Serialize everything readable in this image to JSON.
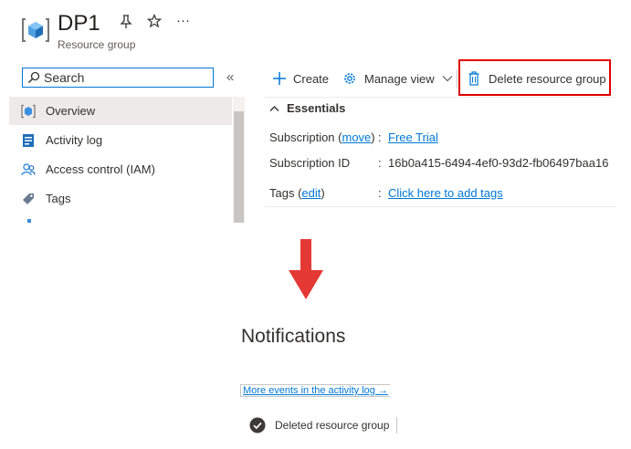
{
  "header": {
    "title": "DP1",
    "subtitle": "Resource group",
    "pin_icon": "pin-icon",
    "star_icon": "star-icon",
    "more_label": "···"
  },
  "search": {
    "placeholder": "Search",
    "value": ""
  },
  "collapse_label": "«",
  "sidebar": {
    "items": [
      {
        "label": "Overview",
        "icon": "resource-group-icon",
        "active": true
      },
      {
        "label": "Activity log",
        "icon": "activity-log-icon"
      },
      {
        "label": "Access control (IAM)",
        "icon": "iam-people-icon"
      },
      {
        "label": "Tags",
        "icon": "tag-icon"
      }
    ]
  },
  "toolbar": {
    "create_label": "Create",
    "manage_view_label": "Manage view",
    "delete_label": "Delete resource group"
  },
  "essentials": {
    "title": "Essentials",
    "subscription_label": "Subscription",
    "subscription_move_link": "move",
    "subscription_value": "Free Trial",
    "subscription_id_label": "Subscription ID",
    "subscription_id_value": "16b0a415-6494-4ef0-93d2-fb06497baa16",
    "tags_label": "Tags",
    "tags_edit_link": "edit",
    "tags_value": "Click here to add tags",
    "separator": ":"
  },
  "notifications": {
    "title": "Notifications",
    "more_events_link": "More events in the activity log →",
    "item_text": "Deleted resource group"
  },
  "colors": {
    "accent": "#0078d4",
    "highlight_box": "#e00000",
    "arrow": "#e53935"
  }
}
